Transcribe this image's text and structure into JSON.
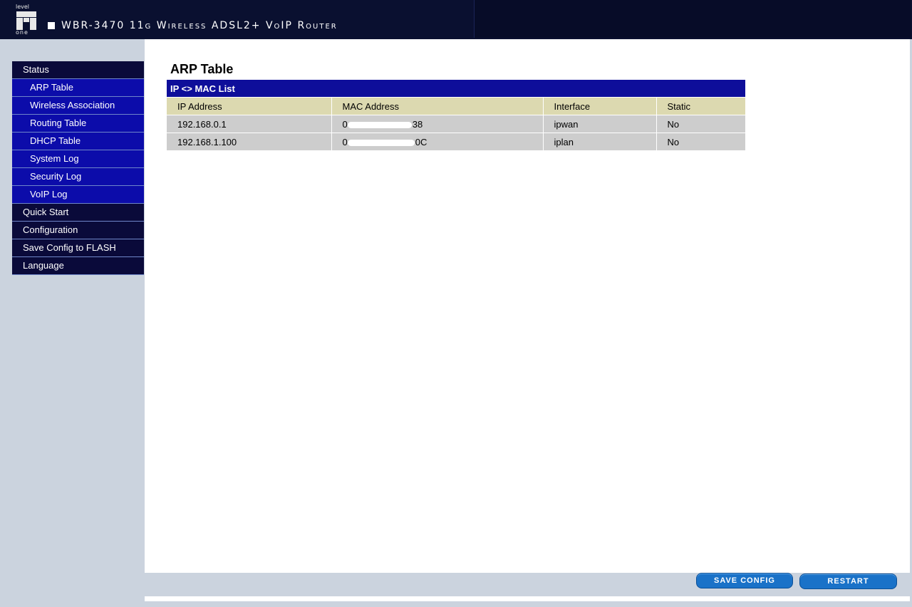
{
  "header": {
    "logo_top": "level",
    "logo_bottom": "one",
    "product_title": "WBR-3470 11g Wireless ADSL2+ VoIP Router"
  },
  "nav": {
    "items": [
      {
        "label": "Status",
        "level": "top"
      },
      {
        "label": "ARP Table",
        "level": "sub"
      },
      {
        "label": "Wireless Association",
        "level": "sub"
      },
      {
        "label": "Routing Table",
        "level": "sub"
      },
      {
        "label": "DHCP Table",
        "level": "sub"
      },
      {
        "label": "System Log",
        "level": "sub"
      },
      {
        "label": "Security Log",
        "level": "sub"
      },
      {
        "label": "VoIP Log",
        "level": "sub"
      },
      {
        "label": "Quick Start",
        "level": "top"
      },
      {
        "label": "Configuration",
        "level": "top"
      },
      {
        "label": "Save Config to FLASH",
        "level": "top"
      },
      {
        "label": "Language",
        "level": "top"
      }
    ]
  },
  "main": {
    "title": "ARP Table",
    "table": {
      "caption": "IP <> MAC List",
      "columns": [
        "IP Address",
        "MAC Address",
        "Interface",
        "Static"
      ],
      "rows": [
        {
          "ip": "192.168.0.1",
          "mac_visible_start": "0",
          "mac_visible_end": "38",
          "interface": "ipwan",
          "static": "No"
        },
        {
          "ip": "192.168.1.100",
          "mac_visible_start": "0",
          "mac_visible_end": "0C",
          "interface": "iplan",
          "static": "No"
        }
      ]
    }
  },
  "buttons": {
    "save_config": "SAVE CONFIG",
    "restart": "RESTART"
  },
  "colors": {
    "header_bg": "#0a1030",
    "nav_top_bg": "#0a0a3a",
    "nav_sub_bg": "#0c0caa",
    "table_caption_bg": "#0e0e9a",
    "table_header_bg": "#dcd9b0",
    "table_cell_bg": "#cdcdcd",
    "button_bg": "#1a72c8"
  }
}
